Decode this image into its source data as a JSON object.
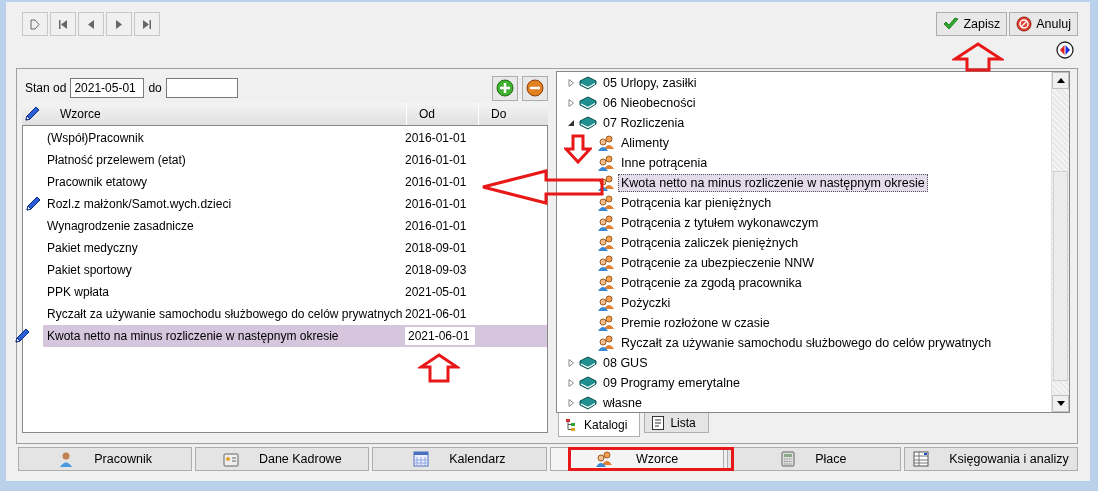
{
  "actions": [
    {
      "kind": "save",
      "label": "Zapisz"
    },
    {
      "kind": "cancel",
      "label": "Anuluj"
    }
  ],
  "filter": {
    "from_label": "Stan od",
    "from": "2021-05-01",
    "to_label": "do"
  },
  "table": {
    "columns": [
      "Wzorce",
      "Od",
      "Do"
    ],
    "rows": [
      {
        "name": "(Współ)Pracownik",
        "od": "2016-01-01",
        "edited": false,
        "selected": false
      },
      {
        "name": "Płatność przelewem (etat)",
        "od": "2016-01-01",
        "edited": false,
        "selected": false
      },
      {
        "name": "Pracownik etatowy",
        "od": "2016-01-01",
        "edited": false,
        "selected": false
      },
      {
        "name": "Rozl.z małżonk/Samot.wych.dzieci",
        "od": "2016-01-01",
        "edited": true,
        "selected": false
      },
      {
        "name": "Wynagrodzenie zasadnicze",
        "od": "2016-01-01",
        "edited": false,
        "selected": false
      },
      {
        "name": "Pakiet medyczny",
        "od": "2018-09-01",
        "edited": false,
        "selected": false
      },
      {
        "name": "Pakiet sportowy",
        "od": "2018-09-03",
        "edited": false,
        "selected": false
      },
      {
        "name": "PPK wpłata",
        "od": "2021-05-01",
        "edited": false,
        "selected": false
      },
      {
        "name": "Ryczałt za używanie samochodu służbowego do celów prywatnych",
        "od": "2021-06-01",
        "edited": false,
        "selected": false
      },
      {
        "name": "Kwota netto na minus rozliczenie w następnym okresie",
        "od": "2021-06-01",
        "edited": true,
        "selected": true
      }
    ]
  },
  "tree": [
    {
      "label": "05 Urlopy, zasiłki",
      "expanded": false
    },
    {
      "label": "06 Nieobecności",
      "expanded": false
    },
    {
      "label": "07 Rozliczenia",
      "expanded": true,
      "children": [
        {
          "label": "Alimenty",
          "selected": false
        },
        {
          "label": "Inne potrącenia",
          "selected": false
        },
        {
          "label": "Kwota netto na minus rozliczenie w następnym okresie",
          "selected": true
        },
        {
          "label": "Potrącenia kar pieniężnych",
          "selected": false
        },
        {
          "label": "Potrącenia z tytułem wykonawczym",
          "selected": false
        },
        {
          "label": "Potrącenia zaliczek pieniężnych",
          "selected": false
        },
        {
          "label": "Potrącenie za ubezpieczenie NNW",
          "selected": false
        },
        {
          "label": "Potrącenie za zgodą pracownika",
          "selected": false
        },
        {
          "label": "Pożyczki",
          "selected": false
        },
        {
          "label": "Premie rozłożone w czasie",
          "selected": false
        },
        {
          "label": "Ryczałt za używanie samochodu służbowego do celów prywatnych",
          "selected": false
        }
      ]
    },
    {
      "label": "08 GUS",
      "expanded": false
    },
    {
      "label": "09 Programy emerytalne",
      "expanded": false
    },
    {
      "label": "własne",
      "expanded": false
    }
  ],
  "tree_tabs": [
    {
      "kind": "tree",
      "label": "Katalogi",
      "selected": true
    },
    {
      "kind": "list",
      "label": "Lista",
      "selected": false
    }
  ],
  "bottom_tabs": [
    {
      "kind": "person",
      "label": "Pracownik",
      "selected": false
    },
    {
      "kind": "card",
      "label": "Dane Kadrowe",
      "selected": false
    },
    {
      "kind": "calendar",
      "label": "Kalendarz",
      "selected": false
    },
    {
      "kind": "people",
      "label": "Wzorce",
      "selected": true
    },
    {
      "kind": "calculator",
      "label": "Płace",
      "selected": false
    },
    {
      "kind": "ledger",
      "label": "Księgowania i analizy",
      "selected": false
    }
  ]
}
